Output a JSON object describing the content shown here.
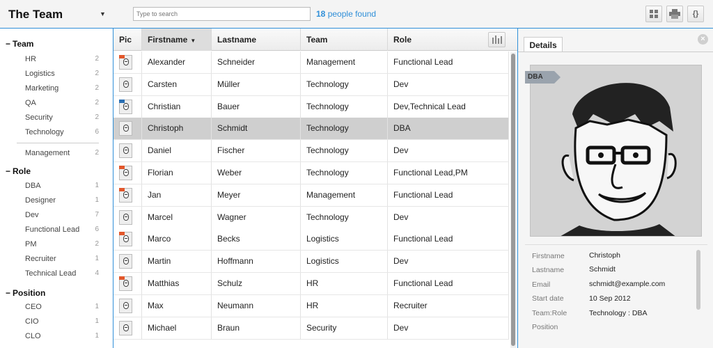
{
  "app": {
    "title": "The Team"
  },
  "search": {
    "placeholder": "Type to search"
  },
  "found": {
    "count": "18",
    "suffix": "people found"
  },
  "toolbar": {
    "icons": [
      "grid-view-icon",
      "print-icon",
      "json-icon"
    ]
  },
  "sidebar": {
    "sections": [
      {
        "label": "Team",
        "items": [
          {
            "label": "HR",
            "count": "2"
          },
          {
            "label": "Logistics",
            "count": "2"
          },
          {
            "label": "Marketing",
            "count": "2"
          },
          {
            "label": "QA",
            "count": "2"
          },
          {
            "label": "Security",
            "count": "2"
          },
          {
            "label": "Technology",
            "count": "6"
          },
          {
            "label": "Management",
            "count": "2"
          }
        ]
      },
      {
        "label": "Role",
        "items": [
          {
            "label": "DBA",
            "count": "1"
          },
          {
            "label": "Designer",
            "count": "1"
          },
          {
            "label": "Dev",
            "count": "7"
          },
          {
            "label": "Functional Lead",
            "count": "6"
          },
          {
            "label": "PM",
            "count": "2"
          },
          {
            "label": "Recruiter",
            "count": "1"
          },
          {
            "label": "Technical Lead",
            "count": "4"
          }
        ]
      },
      {
        "label": "Position",
        "items": [
          {
            "label": "CEO",
            "count": "1"
          },
          {
            "label": "CIO",
            "count": "1"
          },
          {
            "label": "CLO",
            "count": "1"
          }
        ]
      }
    ]
  },
  "table": {
    "headers": {
      "pic": "Pic",
      "firstname": "Firstname",
      "lastname": "Lastname",
      "team": "Team",
      "role": "Role"
    },
    "rows": [
      {
        "first": "Alexander",
        "last": "Schneider",
        "team": "Management",
        "role": "Functional Lead",
        "flag": "#e2572b"
      },
      {
        "first": "Carsten",
        "last": "Müller",
        "team": "Technology",
        "role": "Dev",
        "flag": ""
      },
      {
        "first": "Christian",
        "last": "Bauer",
        "team": "Technology",
        "role": "Dev,Technical Lead",
        "flag": "#2a6fb3"
      },
      {
        "first": "Christoph",
        "last": "Schmidt",
        "team": "Technology",
        "role": "DBA",
        "flag": ""
      },
      {
        "first": "Daniel",
        "last": "Fischer",
        "team": "Technology",
        "role": "Dev",
        "flag": ""
      },
      {
        "first": "Florian",
        "last": "Weber",
        "team": "Technology",
        "role": "Functional Lead,PM",
        "flag": "#e2572b"
      },
      {
        "first": "Jan",
        "last": "Meyer",
        "team": "Management",
        "role": "Functional Lead",
        "flag": "#e2572b"
      },
      {
        "first": "Marcel",
        "last": "Wagner",
        "team": "Technology",
        "role": "Dev",
        "flag": ""
      },
      {
        "first": "Marco",
        "last": "Becks",
        "team": "Logistics",
        "role": "Functional Lead",
        "flag": "#e2572b"
      },
      {
        "first": "Martin",
        "last": "Hoffmann",
        "team": "Logistics",
        "role": "Dev",
        "flag": ""
      },
      {
        "first": "Matthias",
        "last": "Schulz",
        "team": "HR",
        "role": "Functional Lead",
        "flag": "#e2572b"
      },
      {
        "first": "Max",
        "last": "Neumann",
        "team": "HR",
        "role": "Recruiter",
        "flag": ""
      },
      {
        "first": "Michael",
        "last": "Braun",
        "team": "Security",
        "role": "Dev",
        "flag": ""
      }
    ],
    "selected_index": 3
  },
  "details": {
    "tab": "Details",
    "role_ribbon": "DBA",
    "fields": [
      {
        "label": "Firstname",
        "value": "Christoph"
      },
      {
        "label": "Lastname",
        "value": "Schmidt"
      },
      {
        "label": "Email",
        "value": "schmidt@example.com"
      },
      {
        "label": "Start date",
        "value": "10 Sep 2012"
      },
      {
        "label": "Team:Role",
        "value": "Technology : DBA"
      },
      {
        "label": "Position",
        "value": ""
      }
    ]
  },
  "colors": {
    "accent": "#2f8fd8",
    "selected_row": "#cfcfcf",
    "flag_orange": "#e2572b",
    "flag_blue": "#2a6fb3"
  }
}
